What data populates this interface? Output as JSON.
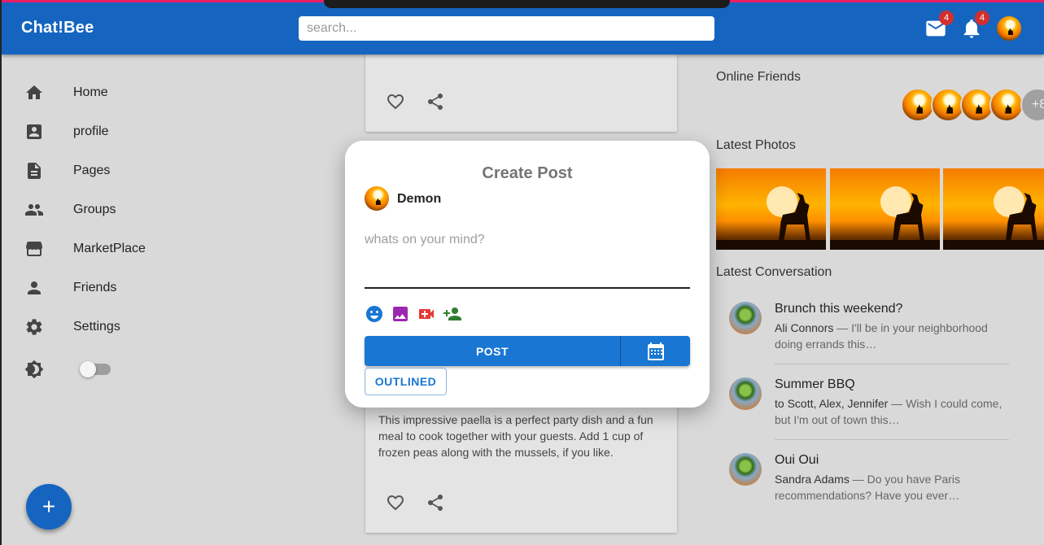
{
  "app": {
    "brand": "Chat!Bee"
  },
  "search": {
    "placeholder": "search..."
  },
  "header": {
    "mail_badge": "4",
    "notif_badge": "4"
  },
  "sidebar": {
    "items": [
      {
        "label": "Home",
        "icon": "home-icon"
      },
      {
        "label": "profile",
        "icon": "account-box-icon"
      },
      {
        "label": "Pages",
        "icon": "description-icon"
      },
      {
        "label": "Groups",
        "icon": "people-icon"
      },
      {
        "label": "MarketPlace",
        "icon": "storefront-icon"
      },
      {
        "label": "Friends",
        "icon": "person-icon"
      },
      {
        "label": "Settings",
        "icon": "gear-icon"
      }
    ],
    "theme_toggle": "off"
  },
  "fab": {
    "label": "+"
  },
  "feed": {
    "post2_text": "This impressive paella is a perfect party dish and a fun meal to cook together with your guests. Add 1 cup of frozen peas along with the mussels, if you like."
  },
  "right": {
    "online_friends_title": "Online Friends",
    "online_more": "+8",
    "latest_photos_title": "Latest Photos",
    "latest_conversation_title": "Latest Conversation",
    "conversations": [
      {
        "title": "Brunch this weekend?",
        "from": "Ali Connors",
        "text": " — I'll be in your neighborhood doing errands this…"
      },
      {
        "title": "Summer BBQ",
        "from": "to Scott, Alex, Jennifer",
        "text": " — Wish I could come, but I'm out of town this…"
      },
      {
        "title": "Oui Oui",
        "from": "Sandra Adams",
        "text": " — Do you have Paris recommendations? Have you ever…"
      }
    ]
  },
  "modal": {
    "title": "Create Post",
    "username": "Demon",
    "placeholder": "whats on your mind?",
    "post_label": "POST",
    "outlined_label": "OUTLINED",
    "colors": {
      "emoji": "#1976d2",
      "image": "#9c27b0",
      "video": "#e53935",
      "tag": "#2e7d32"
    }
  }
}
